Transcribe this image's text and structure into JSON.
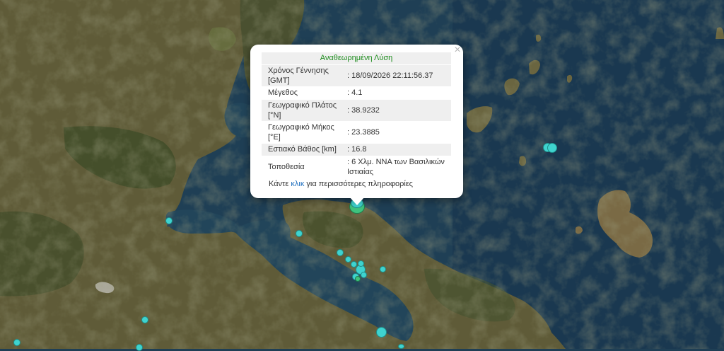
{
  "popup": {
    "title": "Αναθεωρημένη Λύση",
    "close": "×",
    "rows": [
      {
        "label": "Χρόνος Γέννησης [GMT]",
        "value": ": 18/09/2026 22:11:56.37"
      },
      {
        "label": "Μέγεθος",
        "value": ": 4.1"
      },
      {
        "label": "Γεωγραφικό Πλάτος [°N]",
        "value": ": 38.9232"
      },
      {
        "label": "Γεωγραφικό Μήκος [°E]",
        "value": ": 23.3885"
      },
      {
        "label": "Εστιακό Βάθος [km]",
        "value": ": 16.8"
      },
      {
        "label": "Τοποθεσία",
        "value": ": 6 Χλμ. ΝΝΑ των Βασιλικών Ιστιαίας"
      }
    ],
    "more_prefix": "Κάντε ",
    "more_link": "κλικ",
    "more_suffix": " για περισσότερες πληροφορίες"
  },
  "colors": {
    "sea": "#1f3f55",
    "land": "#5c5a36",
    "forest": "#3b4a27",
    "marker_cyan": "#3fd3cf",
    "marker_green": "#3fc27e",
    "title_green": "#1d8c1d",
    "link_blue": "#1f6fbf"
  }
}
